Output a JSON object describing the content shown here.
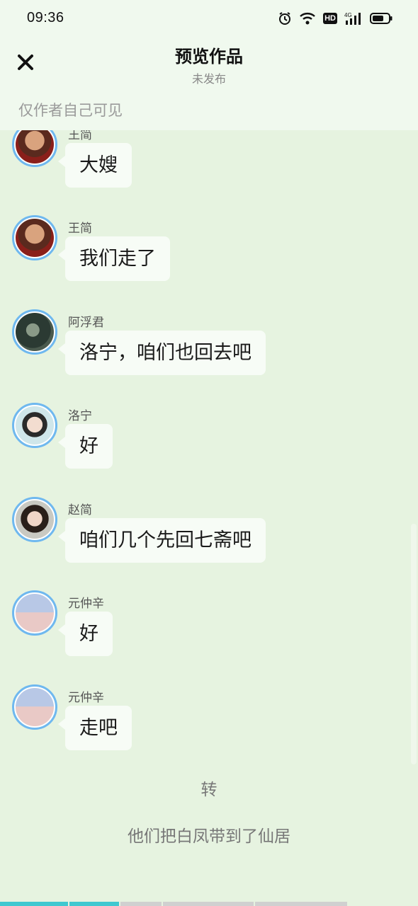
{
  "status_bar": {
    "time": "09:36",
    "icons": [
      "alarm-icon",
      "wifi-icon",
      "hd-icon",
      "4g-signal-icon",
      "battery-icon"
    ],
    "hd_label": "HD"
  },
  "header": {
    "title": "预览作品",
    "subtitle": "未发布",
    "close_icon": "close-icon"
  },
  "visibility_note": "仅作者自己可见",
  "messages": [
    {
      "sender": "王简",
      "text": "大嫂"
    },
    {
      "sender": "王简",
      "text": "我们走了"
    },
    {
      "sender": "阿浮君",
      "text": "洛宁，咱们也回去吧"
    },
    {
      "sender": "洛宁",
      "text": "好"
    },
    {
      "sender": "赵简",
      "text": "咱们几个先回七斋吧"
    },
    {
      "sender": "元仲辛",
      "text": "好"
    },
    {
      "sender": "元仲辛",
      "text": "走吧"
    }
  ],
  "narration": [
    "转",
    "他们把白凤带到了仙居"
  ],
  "progress": {
    "segments": [
      {
        "fill": 1.0,
        "color": "#40c8d0"
      },
      {
        "fill": 1.0,
        "color": "#40c8d0"
      },
      {
        "fill": 0.0,
        "color": "#d0d0d0"
      },
      {
        "fill": 0.0,
        "color": "#d0d0d0"
      },
      {
        "fill": 0.0,
        "color": "#d0d0d0"
      }
    ]
  },
  "colors": {
    "background": "#e6f3e0",
    "header_bg": "#f0f9ee",
    "bubble_bg": "#f7fcf6",
    "avatar_ring": "#6fb8ef"
  }
}
